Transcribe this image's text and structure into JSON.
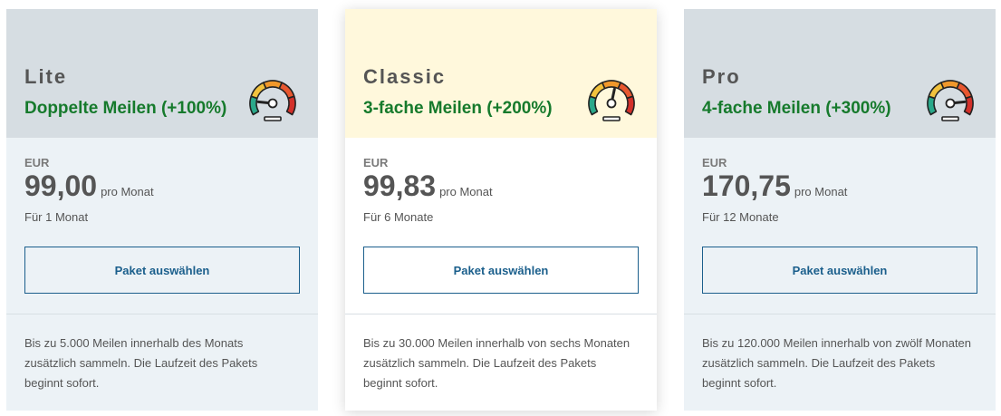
{
  "plans": [
    {
      "name": "Lite",
      "tag": "Doppelte Meilen (+100%)",
      "currency": "EUR",
      "price": "99,00",
      "per": "pro Monat",
      "duration": "Für 1 Monat",
      "button": "Paket auswählen",
      "description": "Bis zu 5.000 Meilen innerhalb des Monats zusätzlich sammeln. Die Laufzeit des Pakets beginnt sofort.",
      "gauge_level": 0.15
    },
    {
      "name": "Classic",
      "tag": "3-fache Meilen (+200%)",
      "currency": "EUR",
      "price": "99,83",
      "per": "pro Monat",
      "duration": "Für 6 Monate",
      "button": "Paket auswählen",
      "description": "Bis zu 30.000 Meilen innerhalb von sechs Monaten zusätzlich sammeln. Die Laufzeit des Pakets beginnt sofort.",
      "gauge_level": 0.55
    },
    {
      "name": "Pro",
      "tag": "4-fache Meilen (+300%)",
      "currency": "EUR",
      "price": "170,75",
      "per": "pro Monat",
      "duration": "Für 12 Monate",
      "button": "Paket auswählen",
      "description": "Bis zu 120.000 Meilen innerhalb von zwölf Monaten zusätzlich sammeln. Die Laufzeit des Pakets beginnt sofort.",
      "gauge_level": 0.85
    }
  ],
  "icons": {
    "gauge": "speedometer-icon"
  },
  "colors": {
    "tag_green": "#167a2c",
    "button_blue": "#1b5f8c",
    "header_grey": "#d6dde2",
    "header_featured": "#fff8dc",
    "card_bg": "#ecf2f6"
  }
}
